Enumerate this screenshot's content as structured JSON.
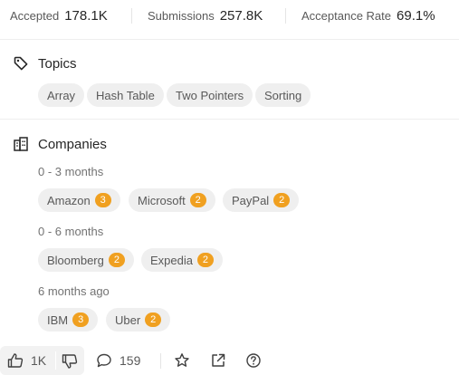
{
  "stats": {
    "accepted_label": "Accepted",
    "accepted_value": "178.1K",
    "submissions_label": "Submissions",
    "submissions_value": "257.8K",
    "acceptance_label": "Acceptance Rate",
    "acceptance_value": "69.1%"
  },
  "topics": {
    "title": "Topics",
    "icon": "tag-icon",
    "tags": [
      "Array",
      "Hash Table",
      "Two Pointers",
      "Sorting"
    ]
  },
  "companies": {
    "title": "Companies",
    "icon": "building-icon",
    "groups": [
      {
        "period": "0 - 3 months",
        "items": [
          {
            "name": "Amazon",
            "count": "3"
          },
          {
            "name": "Microsoft",
            "count": "2"
          },
          {
            "name": "PayPal",
            "count": "2"
          }
        ]
      },
      {
        "period": "0 - 6 months",
        "items": [
          {
            "name": "Bloomberg",
            "count": "2"
          },
          {
            "name": "Expedia",
            "count": "2"
          }
        ]
      },
      {
        "period": "6 months ago",
        "items": [
          {
            "name": "IBM",
            "count": "3"
          },
          {
            "name": "Uber",
            "count": "2"
          }
        ]
      }
    ]
  },
  "footer": {
    "likes": "1K",
    "comments": "159"
  },
  "colors": {
    "badge": "#f0a020",
    "chip_bg": "#efefef"
  }
}
